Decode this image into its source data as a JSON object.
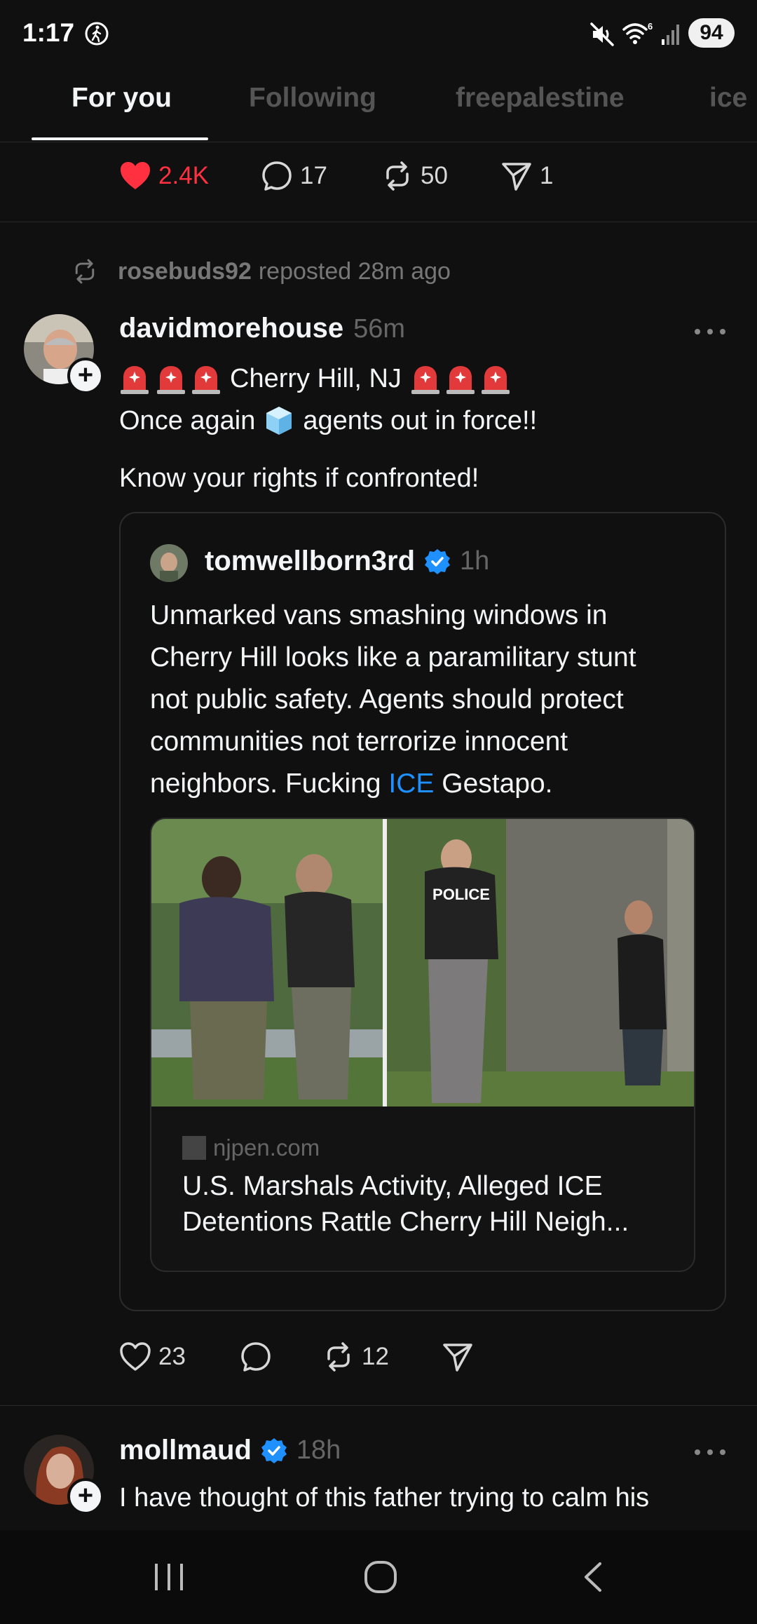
{
  "status": {
    "time": "1:17",
    "battery": "94"
  },
  "tabs": [
    {
      "label": "For you",
      "active": true
    },
    {
      "label": "Following",
      "active": false
    },
    {
      "label": "freepalestine",
      "active": false
    },
    {
      "label": "ice",
      "active": false
    }
  ],
  "top_post_actions": {
    "likes": "2.4K",
    "comments": "17",
    "reposts": "50",
    "shares": "1"
  },
  "repost_info": {
    "user": "rosebuds92",
    "text": "reposted 28m ago"
  },
  "post": {
    "username": "davidmorehouse",
    "time": "56m",
    "line1_text": "Cherry Hill, NJ",
    "line2_before": "Once again",
    "line2_after": "agents out in force!!",
    "line3": "Know your rights if confronted!",
    "actions": {
      "likes": "23",
      "reposts": "12"
    }
  },
  "quote": {
    "username": "tomwellborn3rd",
    "time": "1h",
    "text_lines": [
      "Unmarked vans smashing windows in",
      "Cherry Hill looks like a paramilitary stunt",
      "not public safety. Agents should protect",
      "communities not terrorize innocent"
    ],
    "last_line_before": "neighbors. Fucking",
    "last_line_link": "ICE",
    "last_line_after": "Gestapo.",
    "photo_vest_text": "POLICE",
    "link": {
      "domain": "njpen.com",
      "title_line1": "U.S. Marshals Activity, Alleged ICE",
      "title_line2": "Detentions Rattle Cherry Hill Neigh..."
    }
  },
  "next_post": {
    "username": "mollmaud",
    "time": "18h",
    "text": "I have thought of this father trying to calm his"
  },
  "colors": {
    "background": "#101010",
    "accent_blue": "#1e90ff",
    "like_red": "#ff3040",
    "muted": "#666666"
  }
}
